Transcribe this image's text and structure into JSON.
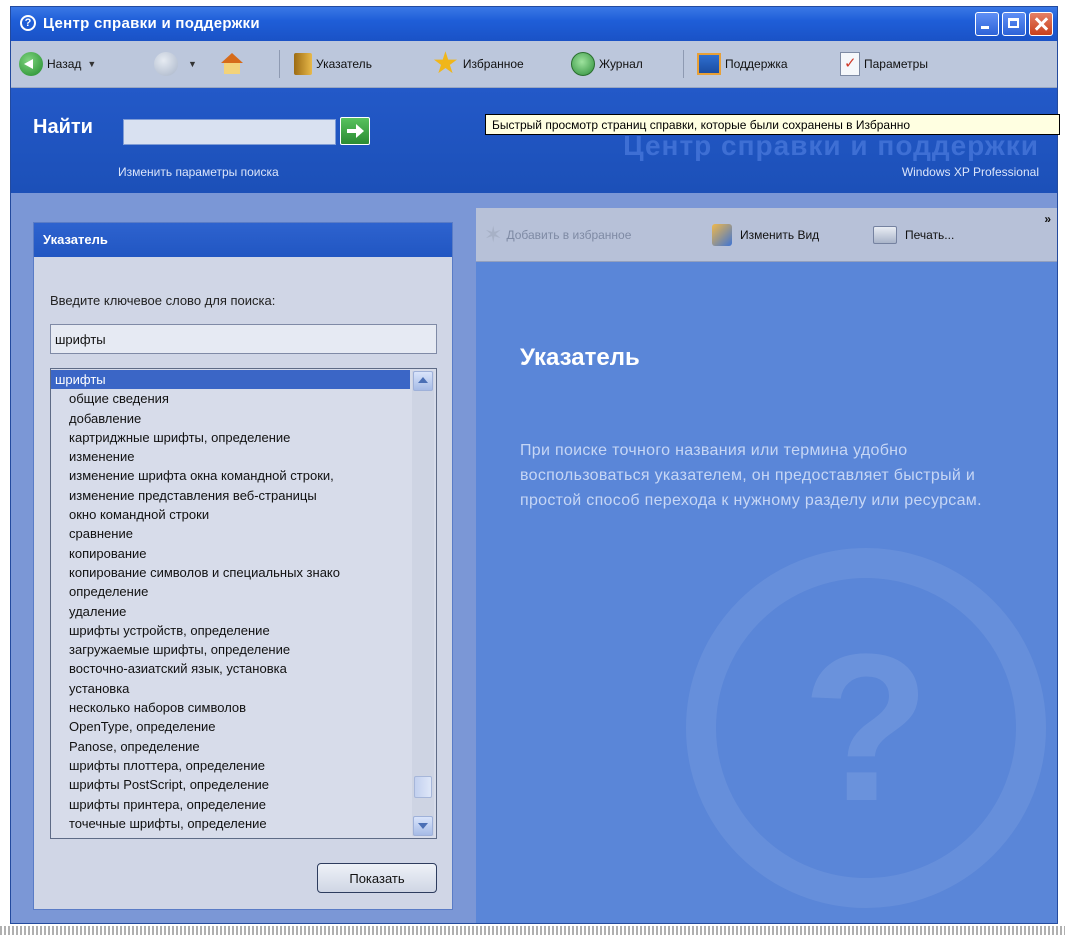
{
  "window": {
    "title": "Центр справки и поддержки"
  },
  "toolbar": {
    "back": "Назад",
    "index": "Указатель",
    "favorites": "Избранное",
    "history": "Журнал",
    "support": "Поддержка",
    "options": "Параметры"
  },
  "search": {
    "label": "Найти",
    "value": "",
    "options_link": "Изменить параметры поиска"
  },
  "banner": {
    "title": "Центр справки и поддержки",
    "edition": "Windows XP Professional"
  },
  "tooltip": "Быстрый просмотр страниц справки, которые были сохранены в Избранно",
  "index_pane": {
    "header": "Указатель",
    "keyword_label": "Введите ключевое слово для поиска:",
    "keyword_value": "шрифты",
    "items": [
      "шрифты",
      "общие сведения",
      "добавление",
      "картриджные шрифты, определение",
      "изменение",
      "изменение шрифта окна командной строки,",
      "изменение представления веб-страницы",
      "окно командной строки",
      "сравнение",
      "копирование",
      "копирование символов и специальных знако",
      "определение",
      "удаление",
      "шрифты устройств, определение",
      "загружаемые шрифты, определение",
      "восточно-азиатский язык, установка",
      "установка",
      "несколько наборов символов",
      "OpenType, определение",
      "Panose, определение",
      "шрифты плоттера, определение",
      "шрифты PostScript, определение",
      "шрифты принтера, определение",
      "точечные шрифты, определение"
    ],
    "selected_index": 0,
    "show_button": "Показать"
  },
  "content": {
    "toolbar": {
      "add_favorite": "Добавить в избранное",
      "change_view": "Изменить Вид",
      "print": "Печать...",
      "more": "»"
    },
    "title": "Указатель",
    "text": "При поиске точного названия или термина удобно воспользоваться указателем, он предоставляет быстрый и простой способ перехода к нужному разделу или ресурсам."
  },
  "colors": {
    "title_bar": "#1f5ed8",
    "search_band": "#1d57c4",
    "content_bg": "#5a86d8",
    "selection": "#3b66c6"
  }
}
